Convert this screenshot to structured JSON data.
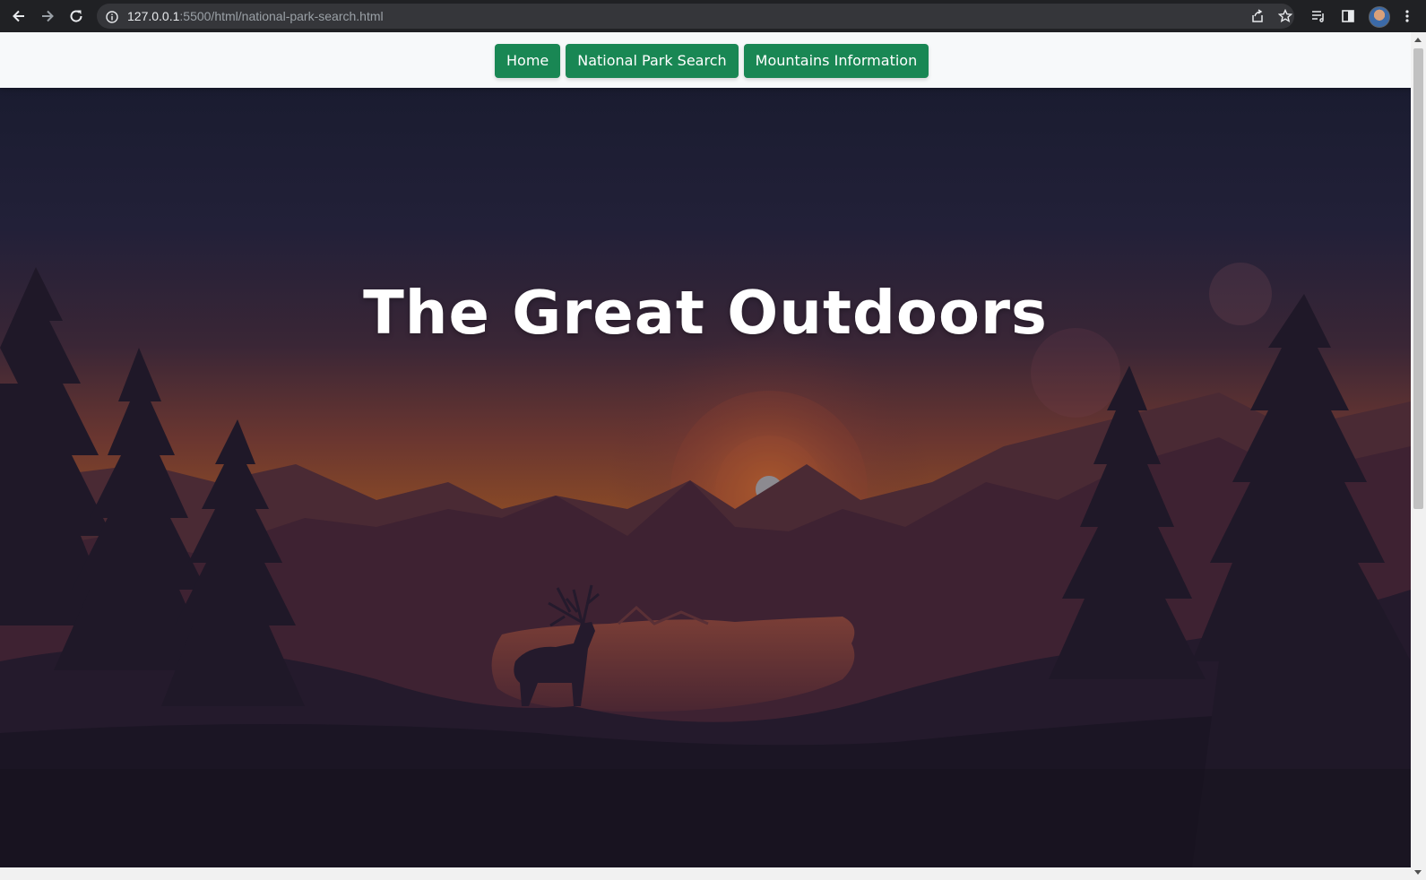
{
  "browser": {
    "url_host": "127.0.0.1",
    "url_rest": ":5500/html/national-park-search.html",
    "back_icon": "back-arrow-icon",
    "forward_icon": "forward-arrow-icon",
    "reload_icon": "reload-icon",
    "info_icon": "site-info-icon",
    "share_icon": "share-icon",
    "bookmark_icon": "star-icon",
    "reading_list_icon": "reading-list-icon",
    "side_panel_icon": "side-panel-icon",
    "menu_icon": "kebab-menu-icon"
  },
  "nav": {
    "links": [
      {
        "label": "Home"
      },
      {
        "label": "National Park Search"
      },
      {
        "label": "Mountains Information"
      }
    ],
    "button_color": "#198754"
  },
  "hero": {
    "title": "The Great Outdoors"
  }
}
